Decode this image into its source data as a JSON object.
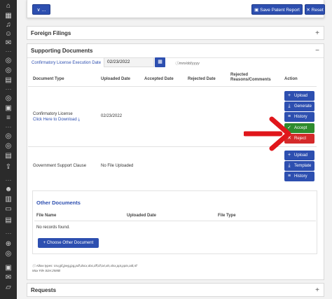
{
  "toolbar": {
    "dropdown_label": "∨ ...",
    "save_label": "Save Patent Report",
    "reset_label": "Reset"
  },
  "sections": {
    "foreign_filings": {
      "title": "Foreign Filings",
      "toggle": "+"
    },
    "supporting_documents": {
      "title": "Supporting Documents",
      "toggle": "−"
    },
    "requests": {
      "title": "Requests",
      "toggle": "+"
    }
  },
  "execution_date": {
    "label": "Confirmatory License Execution Date",
    "value": "02/23/2022",
    "hint": "mm/dd/yyyy"
  },
  "documents_table": {
    "headers": {
      "type": "Document Type",
      "uploaded": "Uploaded Date",
      "accepted": "Accepted Date",
      "rejected": "Rejected Date",
      "reasons_1": "Rejected",
      "reasons_2": "Reasons/Comments",
      "action": "Action"
    },
    "rows": [
      {
        "type": "Confirmatory License",
        "link": "Click Here to Download",
        "uploaded": "02/23/2022",
        "actions": [
          "Upload",
          "Generate",
          "History",
          "Accept",
          "Reject"
        ]
      },
      {
        "type": "Government Support Clause",
        "uploaded": "No File Uploaded",
        "actions": [
          "Upload",
          "Template",
          "History"
        ]
      }
    ]
  },
  "other_documents": {
    "title": "Other Documents",
    "headers": {
      "name": "File Name",
      "uploaded": "Uploaded Date",
      "type": "File Type"
    },
    "empty": "No records found.",
    "add_button": "Choose Other Document"
  },
  "file_hints": {
    "types": "Allow types: csv,gif,jpeg,jpg,pdf,docx,doc,tiff,tif,txt,xls,xlsx,ppt,pptx,odt,rtf",
    "max_size": "Max File Size:25MB"
  },
  "colors": {
    "primary": "#2d4fb0",
    "accept": "#2e8b2e",
    "reject": "#d42a2a",
    "arrow": "#e0161b",
    "rail": "#2b2b2b"
  }
}
